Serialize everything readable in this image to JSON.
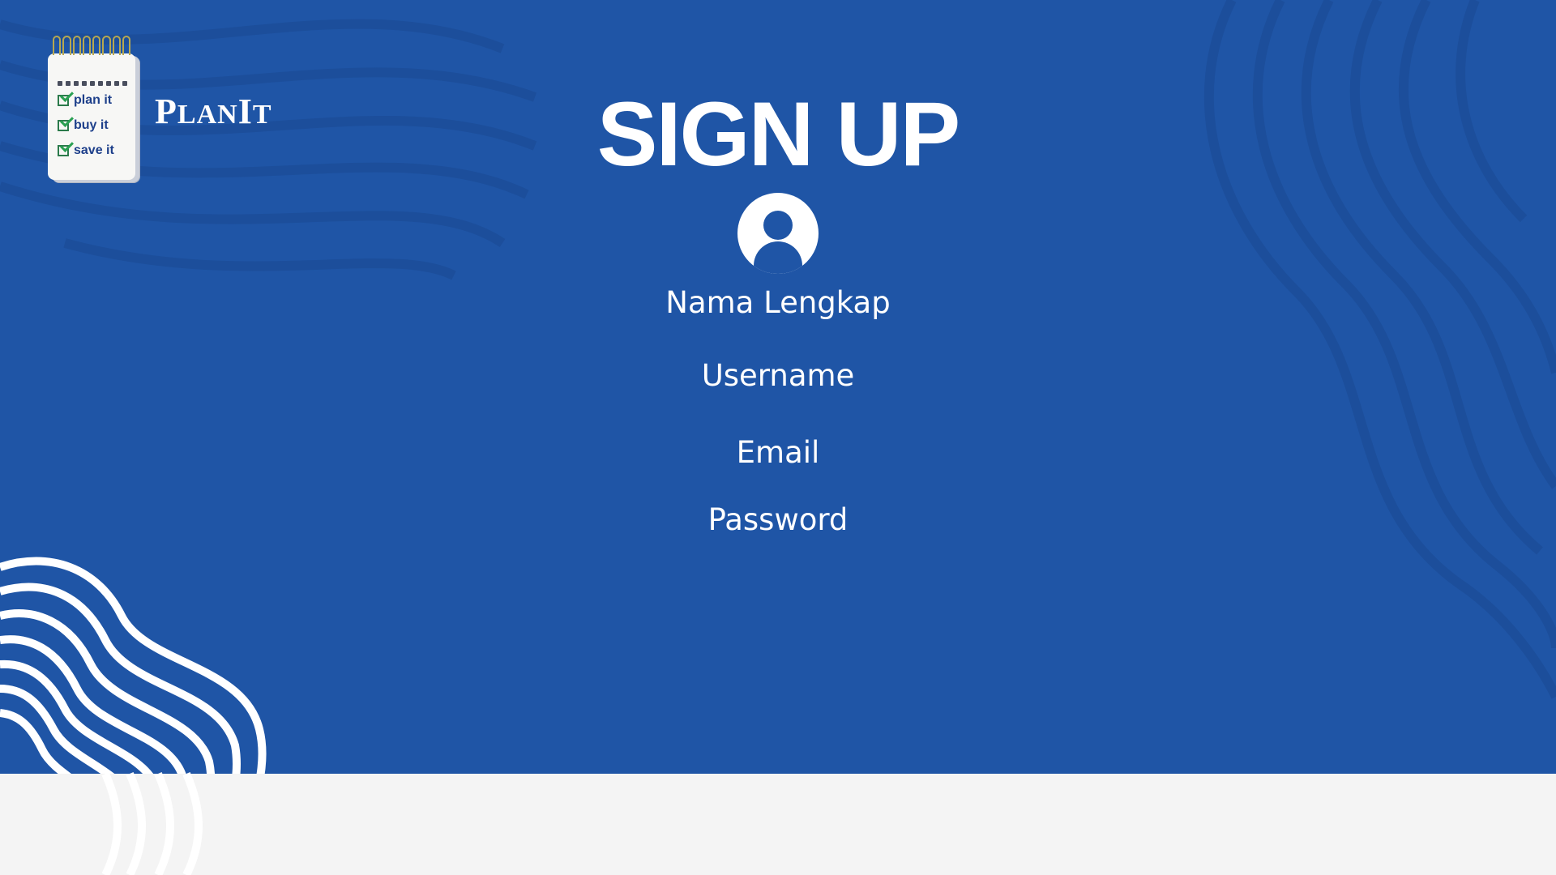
{
  "app": {
    "brand_name": "PlanIt",
    "brand_initial_1": "P",
    "brand_rest_1": "LAN",
    "brand_initial_2": "I",
    "brand_rest_2": "T"
  },
  "logo": {
    "checklist": [
      "plan it",
      "buy it",
      "save it"
    ]
  },
  "form": {
    "title": "SIGN UP",
    "fields": {
      "full_name": "Nama Lengkap",
      "username": "Username",
      "email": "Email",
      "password": "Password"
    }
  },
  "colors": {
    "background": "#1f55a6",
    "footer": "#f4f4f4",
    "text": "#ffffff",
    "checklist_text": "#1d3f8a",
    "check_mark": "#2aa052"
  },
  "icons": {
    "avatar": "user-avatar-icon",
    "check": "checkbox-checked-icon"
  }
}
